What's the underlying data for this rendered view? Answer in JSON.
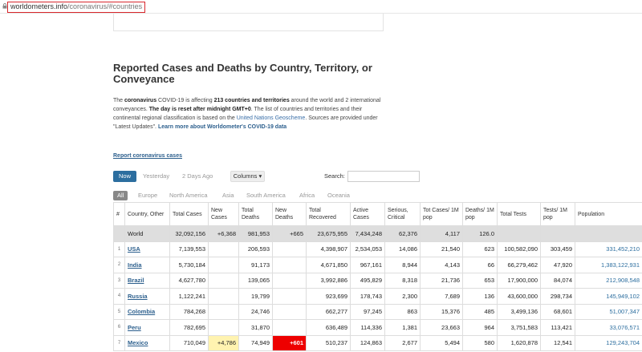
{
  "browser": {
    "url_domain": "worldometers.info",
    "url_path": "/coronavirus/#countries"
  },
  "page": {
    "heading": "Reported Cases and Deaths by Country, Territory, or Conveyance",
    "intro": {
      "p1": "The ",
      "p2": "coronavirus",
      "p3": " COVID-19 is affecting ",
      "p4": "213 countries and territories",
      "p5": " around the world and 2 international conveyances. ",
      "p6": "The day is reset after midnight GMT+0",
      "p7": ". The list of countries and territories and their continental regional classification is based on the ",
      "p8": "United Nations Geoscheme",
      "p9": ". Sources are provided under \"Latest Updates\". ",
      "p10": "Learn more about Worldometer's COVID-19 data"
    },
    "report_link": "Report coronavirus cases"
  },
  "controls": {
    "now": "Now",
    "yesterday": "Yesterday",
    "two_days_ago": "2 Days Ago",
    "columns": "Columns ▾",
    "search_label": "Search:",
    "search_value": ""
  },
  "regions": [
    "All",
    "Europe",
    "North America",
    "Asia",
    "South America",
    "Africa",
    "Oceania"
  ],
  "table": {
    "headers": [
      "#",
      "Country, Other",
      "Total Cases",
      "New Cases",
      "Total Deaths",
      "New Deaths",
      "Total Recovered",
      "Active Cases",
      "Serious, Critical",
      "Tot Cases/ 1M pop",
      "Deaths/ 1M pop",
      "Total Tests",
      "Tests/ 1M pop",
      "Population"
    ],
    "world": [
      "",
      "World",
      "32,092,156",
      "+6,368",
      "981,953",
      "+665",
      "23,675,955",
      "7,434,248",
      "62,376",
      "4,117",
      "126.0",
      "",
      "",
      ""
    ],
    "rows": [
      [
        "1",
        "USA",
        "7,139,553",
        "",
        "206,593",
        "",
        "4,398,907",
        "2,534,053",
        "14,086",
        "21,540",
        "623",
        "100,582,090",
        "303,459",
        "331,452,210"
      ],
      [
        "2",
        "India",
        "5,730,184",
        "",
        "91,173",
        "",
        "4,671,850",
        "967,161",
        "8,944",
        "4,143",
        "66",
        "66,279,462",
        "47,920",
        "1,383,122,931"
      ],
      [
        "3",
        "Brazil",
        "4,627,780",
        "",
        "139,065",
        "",
        "3,992,886",
        "495,829",
        "8,318",
        "21,736",
        "653",
        "17,900,000",
        "84,074",
        "212,908,548"
      ],
      [
        "4",
        "Russia",
        "1,122,241",
        "",
        "19,799",
        "",
        "923,699",
        "178,743",
        "2,300",
        "7,689",
        "136",
        "43,600,000",
        "298,734",
        "145,949,102"
      ],
      [
        "5",
        "Colombia",
        "784,268",
        "",
        "24,746",
        "",
        "662,277",
        "97,245",
        "863",
        "15,376",
        "485",
        "3,499,136",
        "68,601",
        "51,007,347"
      ],
      [
        "6",
        "Peru",
        "782,695",
        "",
        "31,870",
        "",
        "636,489",
        "114,336",
        "1,381",
        "23,663",
        "964",
        "3,751,583",
        "113,421",
        "33,076,571"
      ],
      [
        "7",
        "Mexico",
        "710,049",
        "+4,786",
        "74,949",
        "+601",
        "510,237",
        "124,863",
        "2,677",
        "5,494",
        "580",
        "1,620,878",
        "12,541",
        "129,243,704"
      ]
    ]
  },
  "colors": {
    "accent": "#2c6e9f",
    "link": "#2c5f8d",
    "world_row": "#dedede",
    "new_cases_highlight": "#fff3b0",
    "new_deaths_highlight": "#ee0000",
    "url_highlight_border": "#d8262c"
  }
}
